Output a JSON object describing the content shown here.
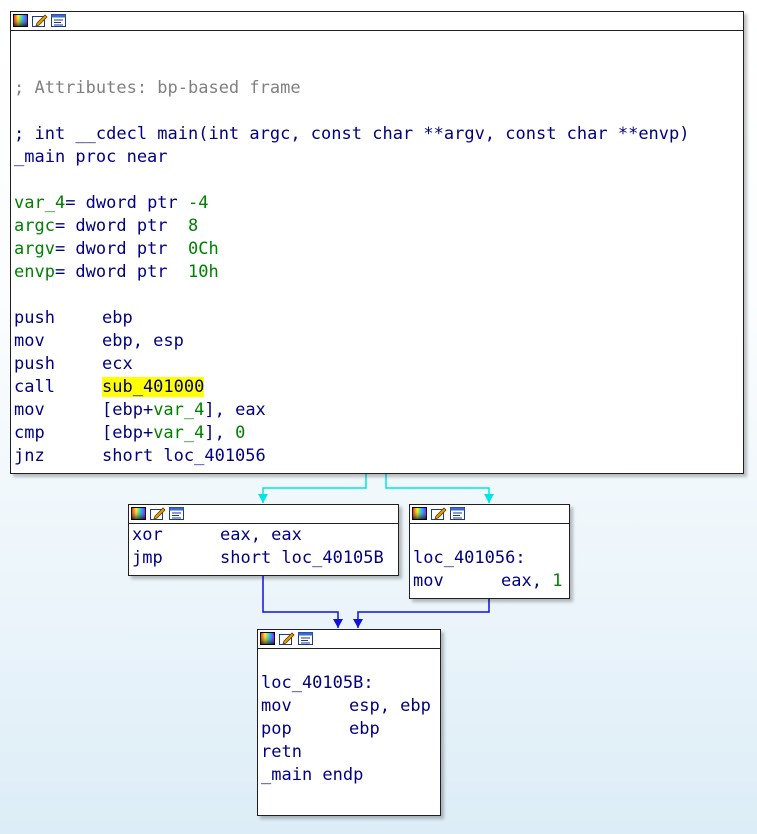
{
  "colors": {
    "instruction": "#000080",
    "comment": "#808080",
    "number_and_var": "#008000",
    "highlight": "#ffff00",
    "edge_true": "#00e5e5",
    "edge_jump": "#1010e0"
  },
  "title_icons": [
    "color-palette-icon",
    "edit-node-icon",
    "graph-view-icon"
  ],
  "main_block": {
    "comment": "; Attributes: bp-based frame",
    "prototype": "; int __cdecl main(int argc, const char **argv, const char **envp)",
    "proc_decl": "_main proc near",
    "vars": [
      {
        "name": "var_4",
        "decl": "= dword ptr ",
        "offset": "-4"
      },
      {
        "name": "argc",
        "decl": "= dword ptr  ",
        "offset": "8"
      },
      {
        "name": "argv",
        "decl": "= dword ptr  ",
        "offset": "0Ch"
      },
      {
        "name": "envp",
        "decl": "= dword ptr  ",
        "offset": "10h"
      }
    ],
    "instr": {
      "i1_mn": "push",
      "i1_op": "ebp",
      "i2_mn": "mov",
      "i2_op": "ebp, esp",
      "i3_mn": "push",
      "i3_op": "ecx",
      "i4_mn": "call",
      "i4_op": "sub_401000",
      "i5_mn": "mov",
      "i5_pre": "[ebp+",
      "i5_var": "var_4",
      "i5_post": "], eax",
      "i6_mn": "cmp",
      "i6_pre": "[ebp+",
      "i6_var": "var_4",
      "i6_post": "], ",
      "i6_num": "0",
      "i7_mn": "jnz",
      "i7_op": "short loc_401056"
    }
  },
  "block_xor": {
    "i1_mn": "xor",
    "i1_op": "eax, eax",
    "i2_mn": "jmp",
    "i2_op": "short loc_40105B"
  },
  "block_loc401056": {
    "label": "loc_401056:",
    "i1_mn": "mov",
    "i1_op": "eax, ",
    "i1_num": "1"
  },
  "block_loc40105b": {
    "label": "loc_40105B:",
    "i1_mn": "mov",
    "i1_op": "esp, ebp",
    "i2_mn": "pop",
    "i2_op": "ebp",
    "i3_mn": "retn",
    "endp": "_main endp"
  }
}
